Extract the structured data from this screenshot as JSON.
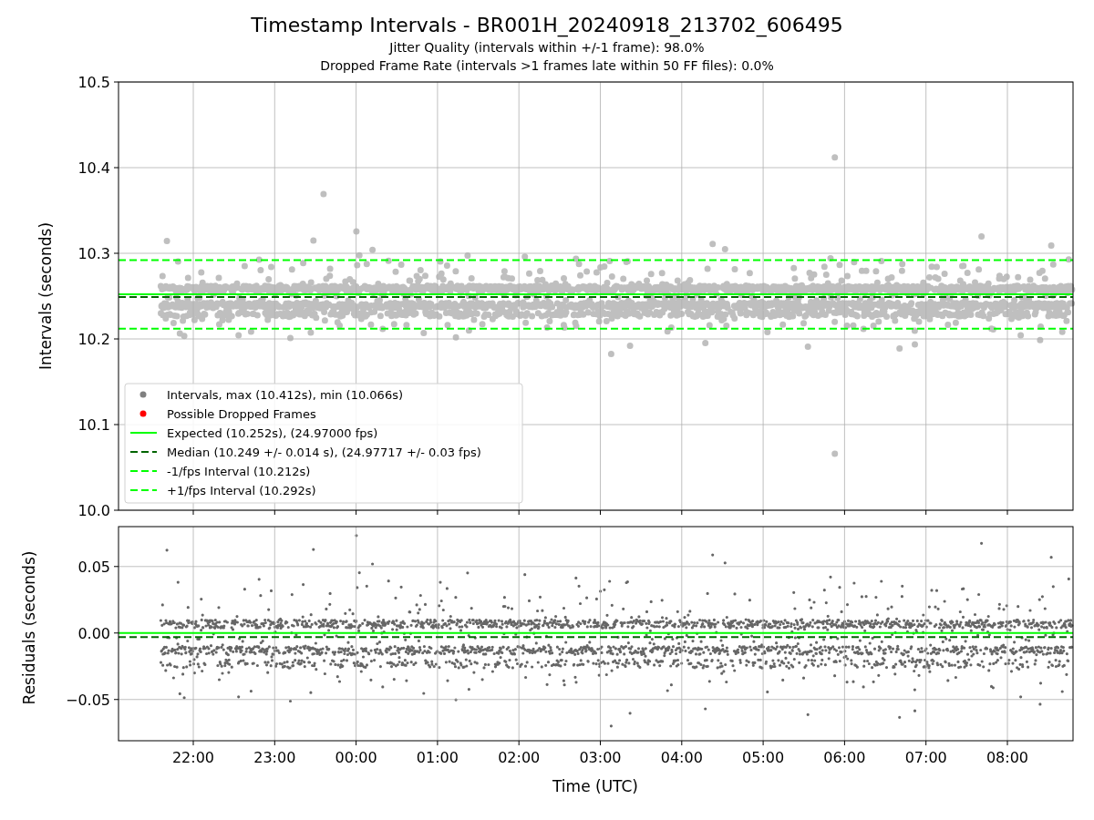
{
  "figure": {
    "title": "Timestamp Intervals - BR001H_20240918_213702_606495",
    "subtitles": [
      "Jitter Quality (intervals within +/-1 frame): 98.0%",
      "Dropped Frame Rate (intervals >1 frames late within 50 FF files): 0.0%"
    ]
  },
  "intervals_plot": {
    "chart_data": {
      "type": "line",
      "ylabel": "Intervals (seconds)",
      "categories": [
        null,
        null,
        null,
        null,
        null,
        null,
        null,
        null,
        null,
        null,
        null
      ],
      "ylim": [
        10.0,
        10.5
      ],
      "grid": true,
      "legend": "lower left",
      "yticks": [
        {
          "value": 10.0,
          "label": "10.0"
        },
        {
          "value": 10.1,
          "label": "10.1"
        },
        {
          "value": 10.2,
          "label": "10.2"
        },
        {
          "value": 10.3,
          "label": "10.3"
        },
        {
          "value": 10.4,
          "label": "10.4"
        },
        {
          "value": 10.5,
          "label": "10.5"
        }
      ],
      "ref_lines": [
        {
          "axis": "y",
          "value": 10.252,
          "label": "Expected (10.252s), (24.97000 fps)",
          "color": "#00ff00",
          "line_style": "solid"
        },
        {
          "axis": "y",
          "value": 10.249,
          "label": "Median (10.249 +/- 0.014 s), (24.97717 +/- 0.03 fps)",
          "color": "#006400",
          "line_style": "dashed"
        },
        {
          "axis": "y",
          "value": 10.212,
          "label": "-1/fps Interval (10.212s)",
          "color": "#00ff00",
          "line_style": "dashed"
        },
        {
          "axis": "y",
          "value": 10.292,
          "label": "+1/fps Interval (10.292s)",
          "color": "#00ff00",
          "line_style": "dashed"
        }
      ]
    },
    "legend_markers": [
      {
        "label": "Intervals, max (10.412s), min (10.066s)",
        "color": "#808080"
      },
      {
        "label": "Possible Dropped Frames",
        "color": "#ff0000"
      }
    ]
  },
  "residuals_plot": {
    "chart_data": {
      "type": "line",
      "xlabel": "Time (UTC)",
      "ylabel": "Residuals (seconds)",
      "ylim": [
        -0.081,
        0.08
      ],
      "grid": true,
      "categories": [
        "22:00",
        "23:00",
        "00:00",
        "01:00",
        "02:00",
        "03:00",
        "04:00",
        "05:00",
        "06:00",
        "07:00",
        "08:00"
      ],
      "yticks": [
        {
          "value": -0.05,
          "label": "−0.05"
        },
        {
          "value": 0,
          "label": "0.00"
        },
        {
          "value": 0.05,
          "label": "0.05"
        }
      ],
      "ref_lines": [
        {
          "axis": "y",
          "value": 0,
          "color": "#00ff00",
          "line_style": "solid"
        },
        {
          "axis": "y",
          "value": -0.003,
          "color": "#006400",
          "line_style": "dashed"
        }
      ]
    }
  }
}
